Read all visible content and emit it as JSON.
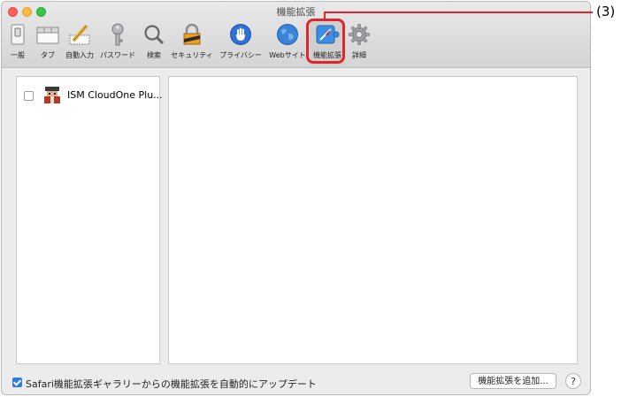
{
  "window": {
    "title": "機能拡張"
  },
  "toolbar": [
    {
      "label": "一般",
      "icon": "general-switch-icon"
    },
    {
      "label": "タブ",
      "icon": "tabs-icon"
    },
    {
      "label": "自動入力",
      "icon": "autofill-pencil-icon"
    },
    {
      "label": "パスワード",
      "icon": "key-icon"
    },
    {
      "label": "検索",
      "icon": "search-icon"
    },
    {
      "label": "セキュリティ",
      "icon": "lock-icon"
    },
    {
      "label": "プライバシー",
      "icon": "hand-icon"
    },
    {
      "label": "Webサイト",
      "icon": "globe-icon"
    },
    {
      "label": "機能拡張",
      "icon": "extensions-icon",
      "selected": true
    },
    {
      "label": "詳細",
      "icon": "gear-icon"
    }
  ],
  "extensions": [
    {
      "name": "ISM CloudOne Plu...",
      "checked": false
    }
  ],
  "bottom": {
    "auto_update_label": "Safari機能拡張ギャラリーからの機能拡張を自動的にアップデート",
    "auto_update_checked": true,
    "add_button_label": "機能拡張を追加...",
    "help_label": "?"
  },
  "annotation": {
    "label": "(3)",
    "color": "#e0262a"
  }
}
